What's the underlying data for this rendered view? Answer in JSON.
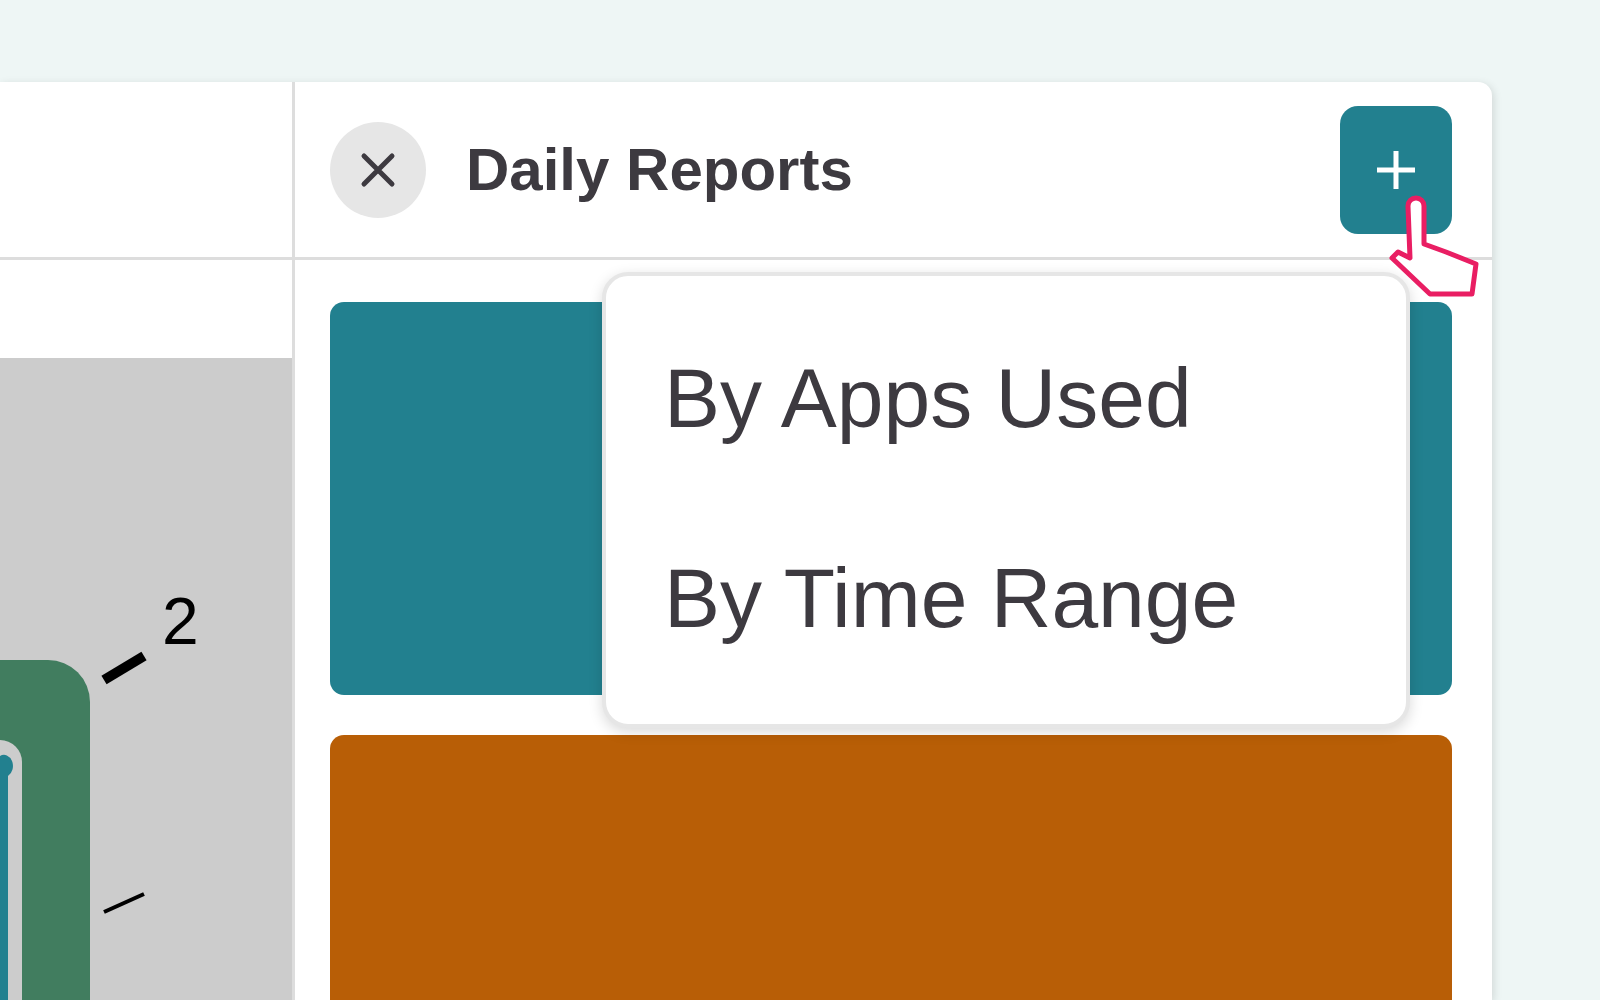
{
  "chart_fragment": {
    "tick_label": "2"
  },
  "panel": {
    "title": "Daily Reports"
  },
  "cards": [
    {
      "color": "#22808f"
    },
    {
      "color": "#b85e06"
    }
  ],
  "menu": {
    "items": [
      {
        "label": "By Apps Used"
      },
      {
        "label": "By Time Range"
      }
    ]
  }
}
